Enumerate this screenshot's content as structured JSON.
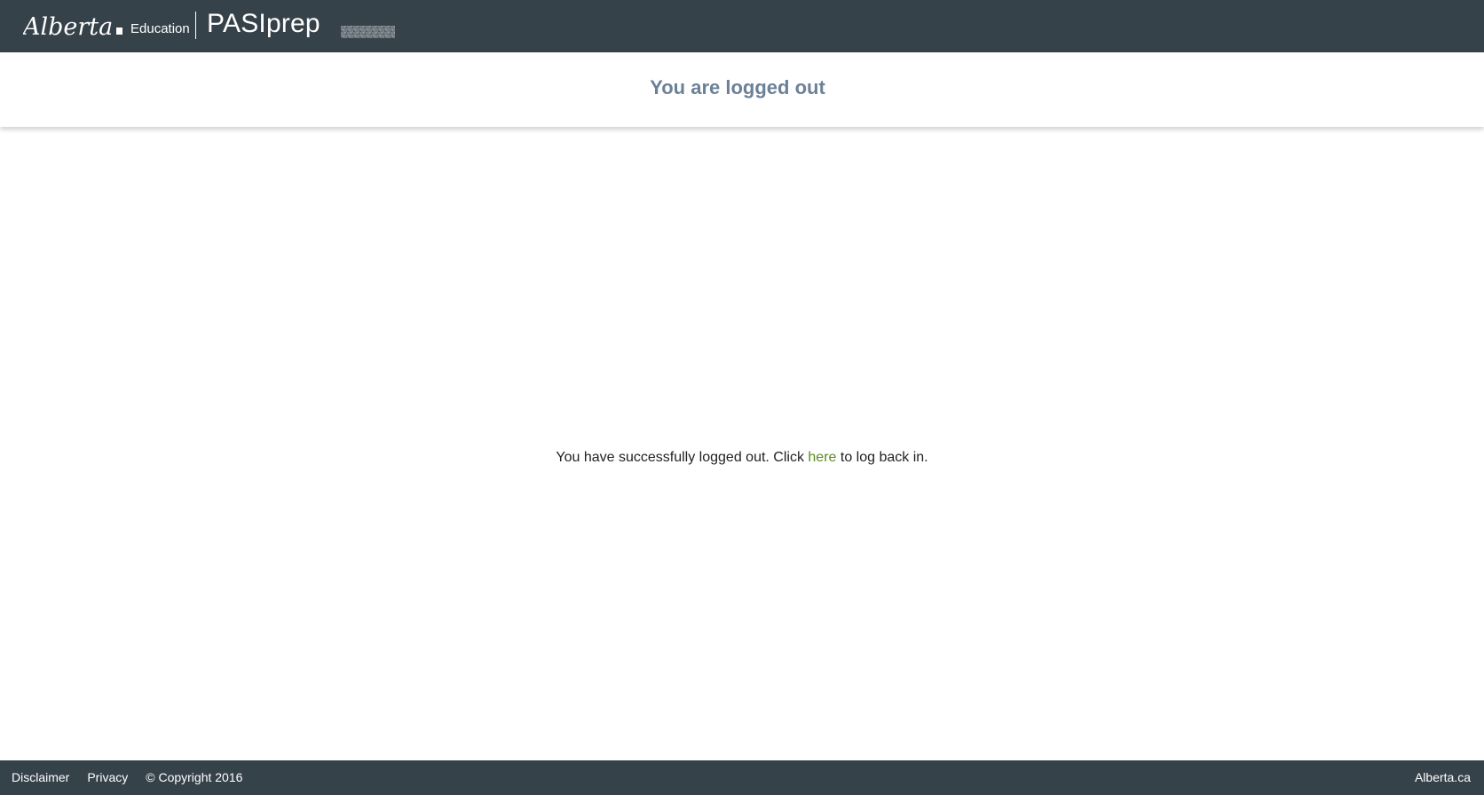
{
  "header": {
    "logo_text": "Alberta",
    "org_label": "Education",
    "app_name": "PASIprep"
  },
  "title": {
    "text": "You are logged out"
  },
  "message": {
    "before_link": "You have successfully logged out. Click ",
    "link_text": "here",
    "after_link": " to log back in."
  },
  "footer": {
    "links": [
      "Disclaimer",
      "Privacy"
    ],
    "copyright": "© Copyright 2016",
    "right_link": "Alberta.ca"
  },
  "colors": {
    "bar_background": "#36424a",
    "title_color": "#6b8198",
    "link_color": "#5b8a1e"
  }
}
